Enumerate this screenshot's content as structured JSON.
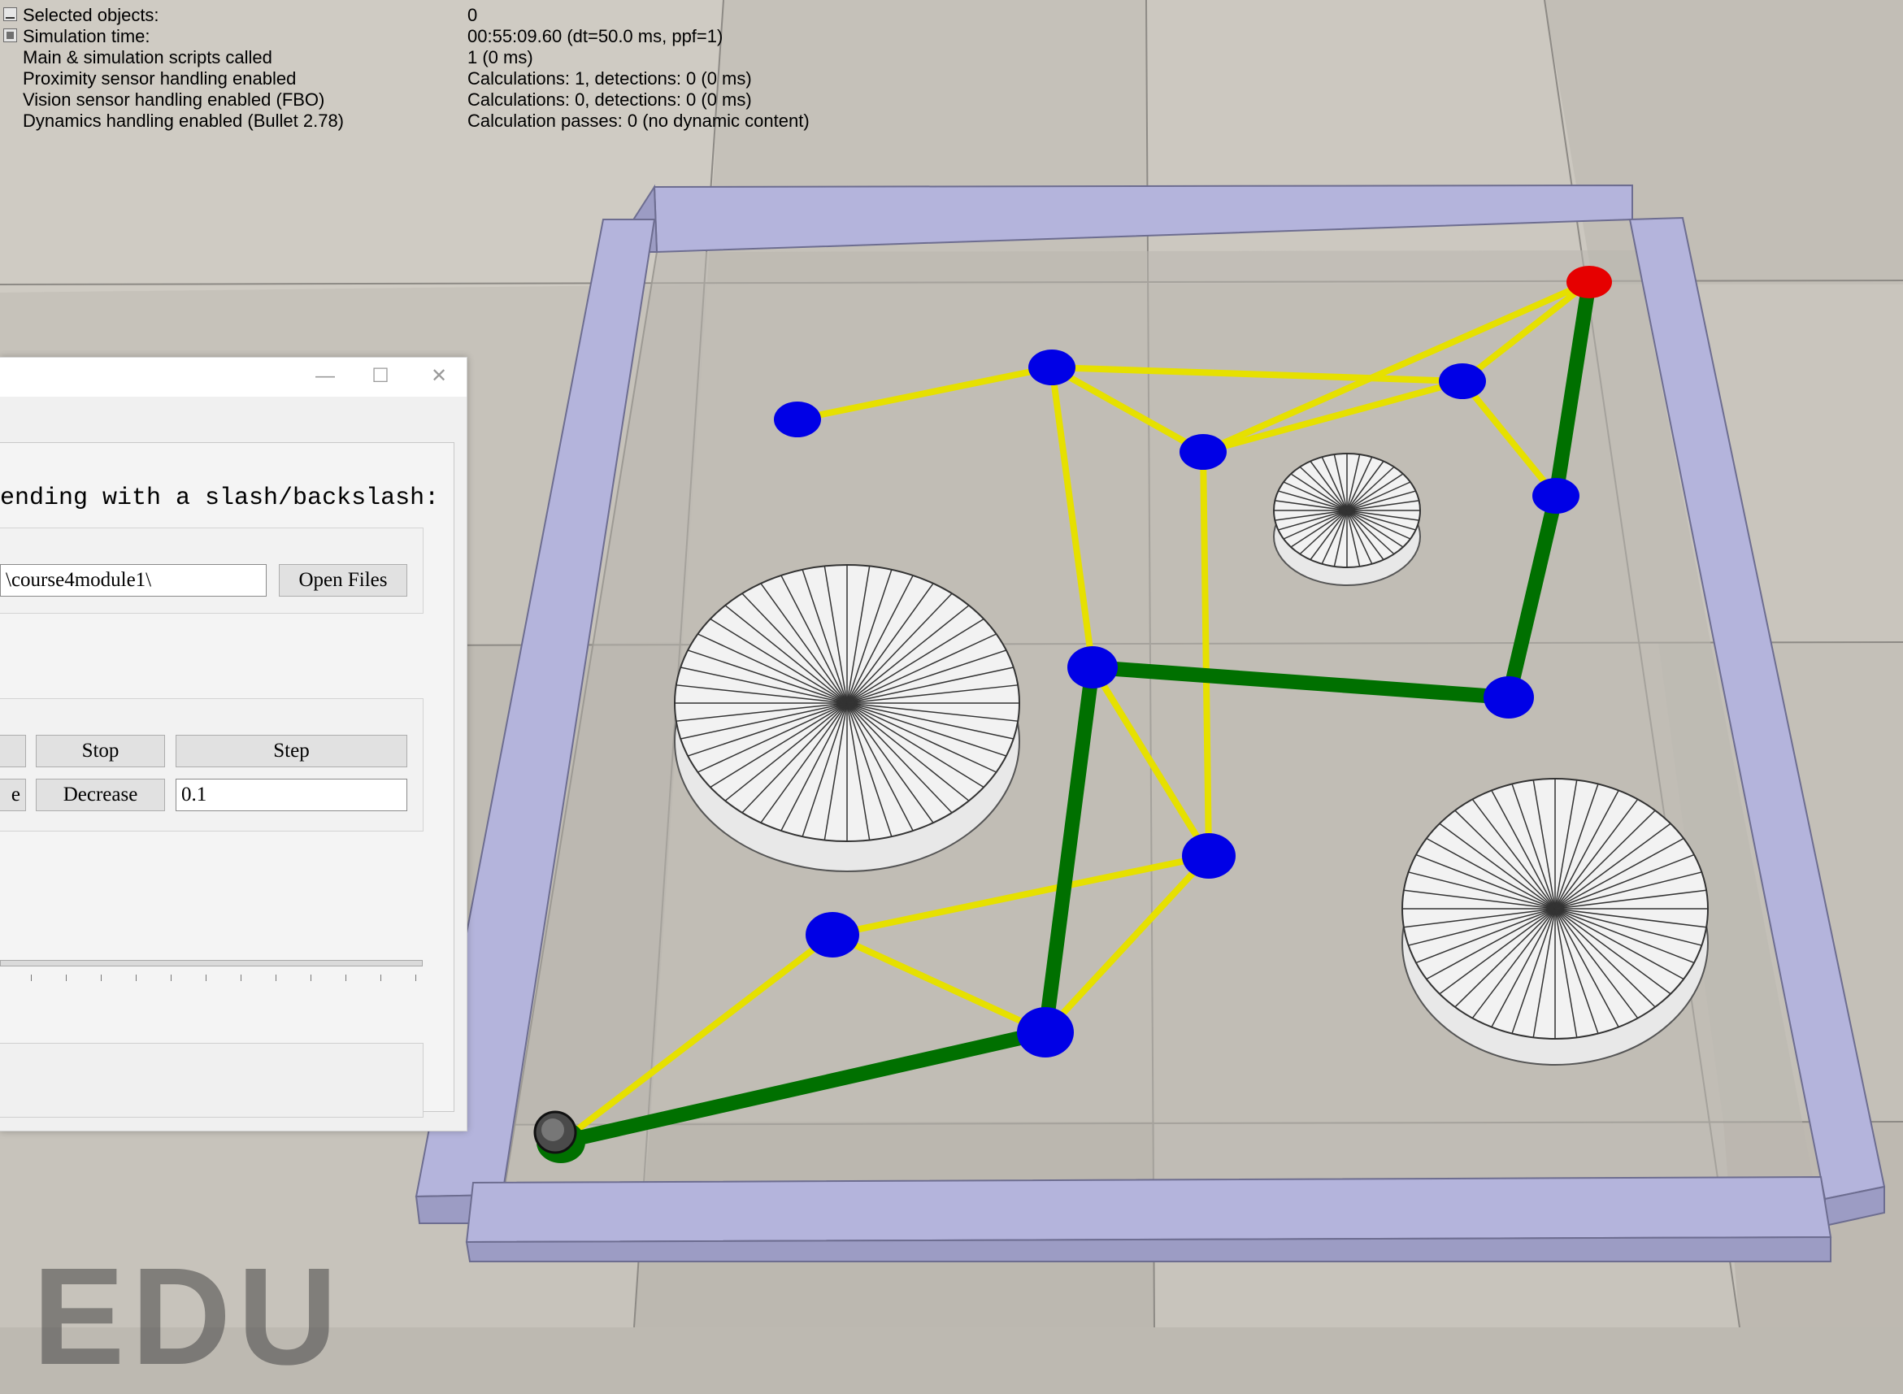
{
  "info": {
    "rows": [
      {
        "label": "Selected objects:",
        "value": "0",
        "checkbox": "underscore"
      },
      {
        "label": "Simulation time:",
        "value": "00:55:09.60 (dt=50.0 ms, ppf=1)",
        "checkbox": "checked"
      },
      {
        "label": "Main & simulation scripts called",
        "value": "1 (0 ms)",
        "checkbox": "none"
      },
      {
        "label": "Proximity sensor handling enabled",
        "value": "Calculations: 1, detections: 0 (0 ms)",
        "checkbox": "none"
      },
      {
        "label": "Vision sensor handling enabled (FBO)",
        "value": "Calculations: 0, detections: 0 (0 ms)",
        "checkbox": "none"
      },
      {
        "label": "Dynamics handling enabled (Bullet 2.78)",
        "value": "Calculation passes: 0 (no dynamic content)",
        "checkbox": "none"
      }
    ]
  },
  "dialog": {
    "titlebar": {
      "minimize_glyph": "—",
      "maximize_glyph": "☐",
      "close_glyph": "✕"
    },
    "path_label": " ending with a slash/backslash:",
    "path_value": "\\course4module1\\",
    "open_files_label": "Open Files",
    "stop_label": "Stop",
    "step_label": "Step",
    "increase_label_partial": "e",
    "decrease_label": "Decrease",
    "step_size_value": "0.1"
  },
  "watermark": {
    "text": "EDU"
  },
  "colors": {
    "wall": "#b4b4dc",
    "wall_dark": "#8e8eb8",
    "graph_edge": "#e6e000",
    "path_edge": "#007000",
    "node": "#0000e6",
    "goal_node": "#e60000",
    "floor": "#c8c4bc"
  },
  "scene": {
    "nodes": [
      {
        "id": "n1",
        "role": "goal"
      },
      {
        "id": "n2",
        "role": "node"
      },
      {
        "id": "n3",
        "role": "node"
      },
      {
        "id": "n4",
        "role": "node"
      },
      {
        "id": "n5",
        "role": "node"
      },
      {
        "id": "n6",
        "role": "node"
      },
      {
        "id": "n7",
        "role": "node"
      },
      {
        "id": "n8",
        "role": "node"
      },
      {
        "id": "n9",
        "role": "node"
      },
      {
        "id": "n10",
        "role": "node"
      },
      {
        "id": "n11",
        "role": "node"
      },
      {
        "id": "n12",
        "role": "start"
      }
    ],
    "edges": [
      [
        "n12",
        "n11"
      ],
      [
        "n11",
        "n9"
      ],
      [
        "n9",
        "n7"
      ],
      [
        "n7",
        "n8"
      ],
      [
        "n8",
        "n6"
      ],
      [
        "n6",
        "n1"
      ],
      [
        "n3",
        "n2"
      ],
      [
        "n3",
        "n4"
      ],
      [
        "n3",
        "n5"
      ],
      [
        "n3",
        "n7"
      ],
      [
        "n5",
        "n4"
      ],
      [
        "n5",
        "n1"
      ],
      [
        "n4",
        "n1"
      ],
      [
        "n4",
        "n6"
      ],
      [
        "n5",
        "n9"
      ],
      [
        "n7",
        "n9"
      ],
      [
        "n9",
        "n10"
      ],
      [
        "n10",
        "n11"
      ],
      [
        "n10",
        "n12"
      ],
      [
        "n9",
        "n11"
      ]
    ],
    "path": [
      "n12",
      "n11",
      "n7",
      "n8",
      "n6",
      "n1"
    ],
    "obstacles": [
      {
        "id": "obstacle-large-left"
      },
      {
        "id": "obstacle-small-top-right"
      },
      {
        "id": "obstacle-large-bottom-right"
      }
    ]
  }
}
